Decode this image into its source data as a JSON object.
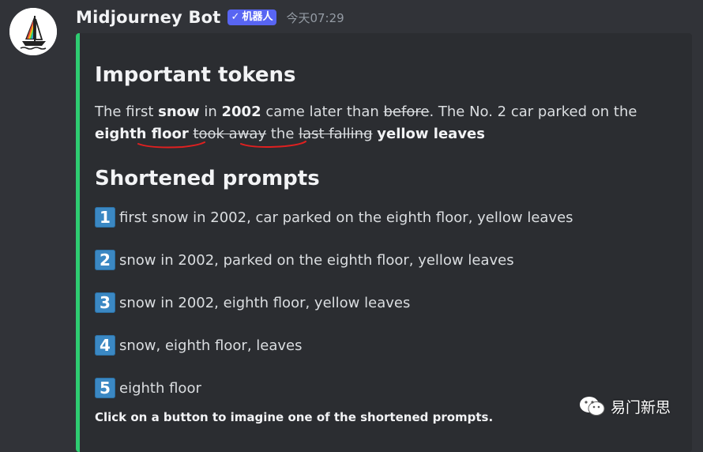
{
  "message": {
    "author": "Midjourney Bot",
    "bot_tag": "机器人",
    "bot_check": "✓",
    "timestamp": "今天07:29"
  },
  "embed": {
    "accent_color": "#2ecc71",
    "title": "Important tokens",
    "text_segments": [
      {
        "t": "The first ",
        "style": "normal"
      },
      {
        "t": "snow",
        "style": "bold"
      },
      {
        "t": " in ",
        "style": "normal"
      },
      {
        "t": "2002",
        "style": "bold"
      },
      {
        "t": " came later than ",
        "style": "normal"
      },
      {
        "t": "before",
        "style": "strike"
      },
      {
        "t": ". The No. 2 car parked on the ",
        "style": "normal"
      },
      {
        "t": "eighth floor",
        "style": "bold"
      },
      {
        "t": " ",
        "style": "normal"
      },
      {
        "t": "took away",
        "style": "strike"
      },
      {
        "t": " the ",
        "style": "normal"
      },
      {
        "t": "last falling",
        "style": "strike"
      },
      {
        "t": " ",
        "style": "normal"
      },
      {
        "t": "yellow leaves",
        "style": "bold"
      }
    ],
    "section_title": "Shortened prompts",
    "prompts": [
      {
        "number": "1",
        "text": "first snow in 2002, car parked on the eighth floor, yellow leaves"
      },
      {
        "number": "2",
        "text": "snow in 2002, parked on the eighth floor, yellow leaves"
      },
      {
        "number": "3",
        "text": "snow in 2002, eighth floor, yellow leaves"
      },
      {
        "number": "4",
        "text": "snow, eighth floor, leaves"
      },
      {
        "number": "5",
        "text": "eighth floor"
      }
    ],
    "footer": "Click on a button to imagine one of the shortened prompts."
  },
  "watermark": {
    "icon": "wechat-icon",
    "text": "易门新思"
  },
  "colors": {
    "background": "#313338",
    "embed_background": "#2b2d31",
    "bot_tag": "#5865f2",
    "keycap": "#3b88c3",
    "annotation": "#e02020"
  }
}
